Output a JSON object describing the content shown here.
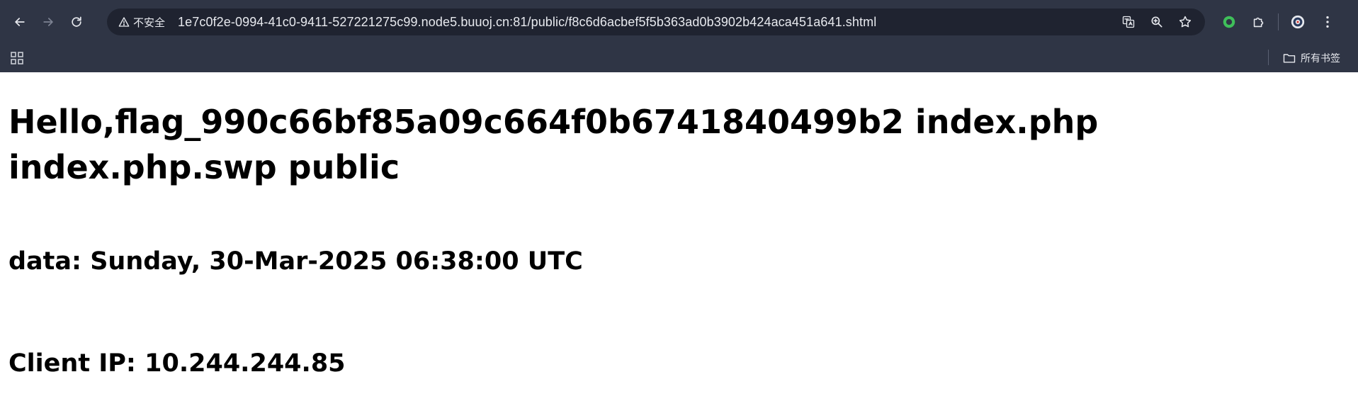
{
  "browser": {
    "security_label": "不安全",
    "url": "1e7c0f2e-0994-41c0-9411-527221275c99.node5.buuoj.cn:81/public/f8c6d6acbef5f5b363ad0b3902b424aca451a641.shtml",
    "bookmarks_label": "所有书签",
    "icons": [
      "back-icon",
      "forward-icon",
      "reload-icon",
      "warning-icon",
      "translate-icon",
      "zoom-icon",
      "star-icon",
      "extension-status-icon",
      "puzzle-icon",
      "profile-icon",
      "more-icon",
      "apps-icon",
      "folder-icon"
    ]
  },
  "page": {
    "title": "Hello,flag_990c66bf85a09c664f0b6741840499b2 index.php index.php.swp public",
    "date_line": "data: Sunday, 30-Mar-2025 06:38:00 UTC",
    "ip_line": "Client IP: 10.244.244.85"
  }
}
